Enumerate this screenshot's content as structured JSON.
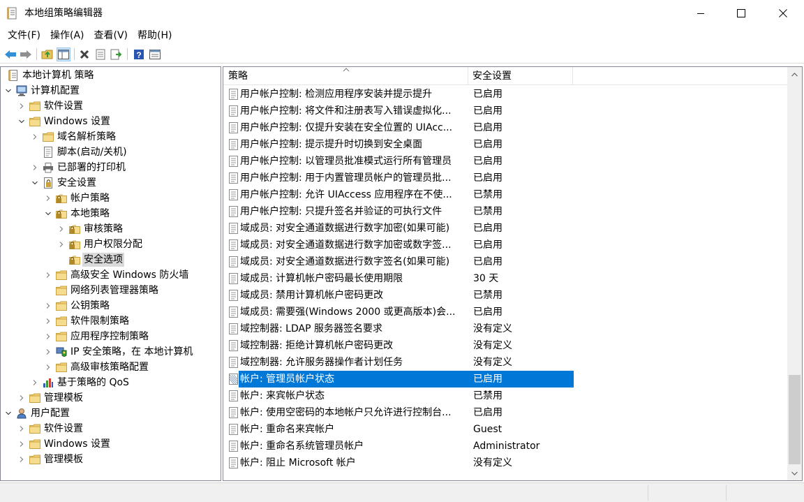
{
  "window": {
    "title": "本地组策略编辑器",
    "icon": "policy-editor-icon"
  },
  "menu": {
    "items": [
      "文件(F)",
      "操作(A)",
      "查看(V)",
      "帮助(H)"
    ]
  },
  "toolbar": {
    "buttons": [
      "back-arrow-icon",
      "forward-arrow-icon",
      "up-folder-icon",
      "show-hide-tree-icon",
      "delete-icon",
      "properties-icon",
      "export-list-icon",
      "help-icon",
      "view-icon"
    ]
  },
  "tree": {
    "items": [
      {
        "label": "本地计算机 策略",
        "indent": 0,
        "expander": "none",
        "icon": "policy-doc-icon"
      },
      {
        "label": "计算机配置",
        "indent": 0,
        "expander": "open",
        "icon": "computer-icon"
      },
      {
        "label": "软件设置",
        "indent": 1,
        "expander": "closed",
        "icon": "folder-icon"
      },
      {
        "label": "Windows 设置",
        "indent": 1,
        "expander": "open",
        "icon": "folder-icon"
      },
      {
        "label": "域名解析策略",
        "indent": 2,
        "expander": "closed",
        "icon": "folder-icon"
      },
      {
        "label": "脚本(启动/关机)",
        "indent": 2,
        "expander": "none",
        "icon": "script-icon"
      },
      {
        "label": "已部署的打印机",
        "indent": 2,
        "expander": "closed",
        "icon": "printer-icon"
      },
      {
        "label": "安全设置",
        "indent": 2,
        "expander": "open",
        "icon": "security-settings-icon"
      },
      {
        "label": "帐户策略",
        "indent": 3,
        "expander": "closed",
        "icon": "lock-folder-icon"
      },
      {
        "label": "本地策略",
        "indent": 3,
        "expander": "open",
        "icon": "lock-folder-icon"
      },
      {
        "label": "审核策略",
        "indent": 4,
        "expander": "closed",
        "icon": "lock-folder-icon"
      },
      {
        "label": "用户权限分配",
        "indent": 4,
        "expander": "closed",
        "icon": "lock-folder-icon"
      },
      {
        "label": "安全选项",
        "indent": 4,
        "expander": "none",
        "icon": "lock-folder-icon",
        "selected": true
      },
      {
        "label": "高级安全 Windows 防火墙",
        "indent": 3,
        "expander": "closed",
        "icon": "folder-icon"
      },
      {
        "label": "网络列表管理器策略",
        "indent": 3,
        "expander": "none",
        "icon": "folder-icon"
      },
      {
        "label": "公钥策略",
        "indent": 3,
        "expander": "closed",
        "icon": "folder-icon"
      },
      {
        "label": "软件限制策略",
        "indent": 3,
        "expander": "closed",
        "icon": "folder-icon"
      },
      {
        "label": "应用程序控制策略",
        "indent": 3,
        "expander": "closed",
        "icon": "folder-icon"
      },
      {
        "label": "IP 安全策略，在 本地计算机",
        "indent": 3,
        "expander": "closed",
        "icon": "ip-security-icon"
      },
      {
        "label": "高级审核策略配置",
        "indent": 3,
        "expander": "closed",
        "icon": "folder-icon"
      },
      {
        "label": "基于策略的 QoS",
        "indent": 2,
        "expander": "closed",
        "icon": "qos-chart-icon"
      },
      {
        "label": "管理模板",
        "indent": 1,
        "expander": "closed",
        "icon": "folder-icon"
      },
      {
        "label": "用户配置",
        "indent": 0,
        "expander": "open",
        "icon": "user-icon"
      },
      {
        "label": "软件设置",
        "indent": 1,
        "expander": "closed",
        "icon": "folder-icon"
      },
      {
        "label": "Windows 设置",
        "indent": 1,
        "expander": "closed",
        "icon": "folder-icon"
      },
      {
        "label": "管理模板",
        "indent": 1,
        "expander": "closed",
        "icon": "folder-icon"
      }
    ]
  },
  "list": {
    "columns": [
      "策略",
      "安全设置"
    ],
    "rows": [
      {
        "policy": "用户帐户控制: 检测应用程序安装并提示提升",
        "setting": "已启用"
      },
      {
        "policy": "用户帐户控制: 将文件和注册表写入错误虚拟化...",
        "setting": "已启用"
      },
      {
        "policy": "用户帐户控制: 仅提升安装在安全位置的 UIAcc...",
        "setting": "已启用"
      },
      {
        "policy": "用户帐户控制: 提示提升时切换到安全桌面",
        "setting": "已启用"
      },
      {
        "policy": "用户帐户控制: 以管理员批准模式运行所有管理员",
        "setting": "已启用"
      },
      {
        "policy": "用户帐户控制: 用于内置管理员帐户的管理员批...",
        "setting": "已启用"
      },
      {
        "policy": "用户帐户控制: 允许 UIAccess 应用程序在不使...",
        "setting": "已禁用"
      },
      {
        "policy": "用户帐户控制: 只提升签名并验证的可执行文件",
        "setting": "已禁用"
      },
      {
        "policy": "域成员: 对安全通道数据进行数字加密(如果可能)",
        "setting": "已启用"
      },
      {
        "policy": "域成员: 对安全通道数据进行数字加密或数字签...",
        "setting": "已启用"
      },
      {
        "policy": "域成员: 对安全通道数据进行数字签名(如果可能)",
        "setting": "已启用"
      },
      {
        "policy": "域成员: 计算机帐户密码最长使用期限",
        "setting": "30 天"
      },
      {
        "policy": "域成员: 禁用计算机帐户密码更改",
        "setting": "已禁用"
      },
      {
        "policy": "域成员: 需要强(Windows 2000 或更高版本)会...",
        "setting": "已启用"
      },
      {
        "policy": "域控制器: LDAP 服务器签名要求",
        "setting": "没有定义"
      },
      {
        "policy": "域控制器: 拒绝计算机帐户密码更改",
        "setting": "没有定义"
      },
      {
        "policy": "域控制器: 允许服务器操作者计划任务",
        "setting": "没有定义"
      },
      {
        "policy": "帐户: 管理员帐户状态",
        "setting": "已启用",
        "selected": true
      },
      {
        "policy": "帐户: 来宾帐户状态",
        "setting": "已禁用"
      },
      {
        "policy": "帐户: 使用空密码的本地帐户只允许进行控制台...",
        "setting": "已启用"
      },
      {
        "policy": "帐户: 重命名来宾帐户",
        "setting": "Guest"
      },
      {
        "policy": "帐户: 重命名系统管理员帐户",
        "setting": "Administrator"
      },
      {
        "policy": "帐户: 阻止 Microsoft 帐户",
        "setting": "没有定义"
      }
    ]
  },
  "colors": {
    "selection": "#0078d7",
    "tree_selection": "#d9d9d9",
    "folder": "#e8c35a"
  }
}
